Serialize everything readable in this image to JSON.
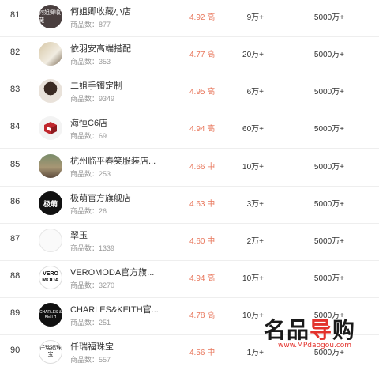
{
  "rows": [
    {
      "rank": "81",
      "name": "何姐卿收藏小店",
      "count_label": "商品数：",
      "count": "877",
      "score": "4.92",
      "level": "高",
      "fans": "9万+",
      "sales": "5000万+",
      "avatar_icon": "store-logo-icon",
      "avatar_text": "何姐卿收藏"
    },
    {
      "rank": "82",
      "name": "依羽安高端搭配",
      "count_label": "商品数：",
      "count": "353",
      "score": "4.77",
      "level": "高",
      "fans": "20万+",
      "sales": "5000万+",
      "avatar_icon": "person-photo-icon",
      "avatar_text": ""
    },
    {
      "rank": "83",
      "name": "二姐手镯定制",
      "count_label": "商品数：",
      "count": "9349",
      "score": "4.95",
      "level": "高",
      "fans": "6万+",
      "sales": "5000万+",
      "avatar_icon": "person-photo-icon",
      "avatar_text": ""
    },
    {
      "rank": "84",
      "name": "海恒C6店",
      "count_label": "商品数：",
      "count": "69",
      "score": "4.94",
      "level": "高",
      "fans": "60万+",
      "sales": "5000万+",
      "avatar_icon": "red-cube-logo-icon",
      "avatar_text": ""
    },
    {
      "rank": "85",
      "name": "杭州临平春笑服装店...",
      "count_label": "商品数：",
      "count": "253",
      "score": "4.66",
      "level": "中",
      "fans": "10万+",
      "sales": "5000万+",
      "avatar_icon": "landscape-photo-icon",
      "avatar_text": ""
    },
    {
      "rank": "86",
      "name": "极萌官方旗舰店",
      "count_label": "商品数：",
      "count": "26",
      "score": "4.63",
      "level": "中",
      "fans": "3万+",
      "sales": "5000万+",
      "avatar_icon": "brand-logo-icon",
      "avatar_text": "极萌"
    },
    {
      "rank": "87",
      "name": "翠玉",
      "count_label": "商品数：",
      "count": "1339",
      "score": "4.60",
      "level": "中",
      "fans": "2万+",
      "sales": "5000万+",
      "avatar_icon": "brand-logo-icon",
      "avatar_text": ""
    },
    {
      "rank": "88",
      "name": "VEROMODA官方旗...",
      "count_label": "商品数：",
      "count": "3270",
      "score": "4.94",
      "level": "高",
      "fans": "10万+",
      "sales": "5000万+",
      "avatar_icon": "brand-logo-icon",
      "avatar_text": "VERO MODA"
    },
    {
      "rank": "89",
      "name": "CHARLES&KEITH官...",
      "count_label": "商品数：",
      "count": "251",
      "score": "4.78",
      "level": "高",
      "fans": "10万+",
      "sales": "5000万+",
      "avatar_icon": "brand-logo-icon",
      "avatar_text": "CHARLES & KEITH"
    },
    {
      "rank": "90",
      "name": "仟瑞福珠宝",
      "count_label": "商品数：",
      "count": "557",
      "score": "4.56",
      "level": "中",
      "fans": "1万+",
      "sales": "5000万+",
      "avatar_icon": "brand-logo-icon",
      "avatar_text": "仟瑞福珠宝"
    }
  ],
  "watermark": {
    "brand_a": "名品",
    "brand_b": "导",
    "brand_c": "购",
    "url": "www.MPdaogou.com"
  }
}
